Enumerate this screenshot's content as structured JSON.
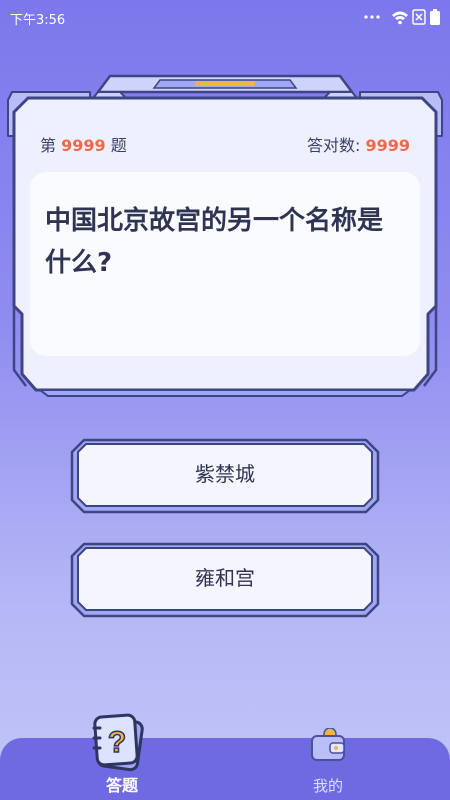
{
  "status_bar": {
    "time": "下午3:56"
  },
  "quiz": {
    "number_prefix": "第",
    "number": "9999",
    "number_suffix": "题",
    "correct_label": "答对数:",
    "correct_count": "9999",
    "question": "中国北京故宫的另一个名称是什么?"
  },
  "options": [
    {
      "label": "紫禁城"
    },
    {
      "label": "雍和宫"
    }
  ],
  "tabbar": {
    "tabs": [
      {
        "label": "答题",
        "icon": "question-book-icon",
        "active": true
      },
      {
        "label": "我的",
        "icon": "wallet-icon",
        "active": false
      }
    ]
  },
  "colors": {
    "background_top": "#7C78EC",
    "background_bottom": "#C2C6F8",
    "accent_number": "#F0674A",
    "frame_outline": "#3F4484",
    "tabbar": "#6E6BE2"
  }
}
